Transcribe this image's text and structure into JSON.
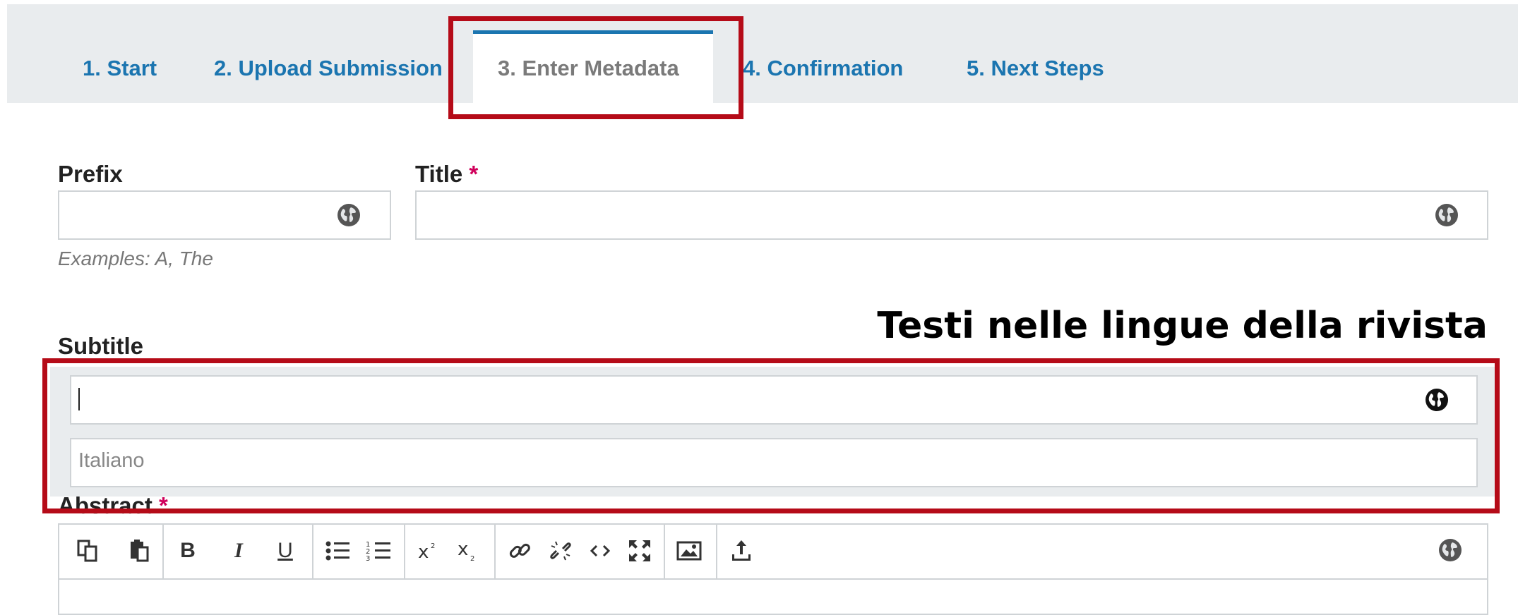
{
  "tabs": [
    {
      "label": "1. Start"
    },
    {
      "label": "2. Upload Submission"
    },
    {
      "label": "3. Enter Metadata"
    },
    {
      "label": "4. Confirmation"
    },
    {
      "label": "5. Next Steps"
    }
  ],
  "active_tab": 2,
  "form": {
    "prefix": {
      "label": "Prefix",
      "value": "",
      "hint": "Examples: A, The"
    },
    "title": {
      "label": "Title",
      "required_mark": "*",
      "value": ""
    },
    "subtitle": {
      "label": "Subtitle",
      "value": "",
      "language_field": "Italiano"
    },
    "abstract": {
      "label": "Abstract",
      "required_mark": "*"
    }
  },
  "annotation": "Testi nelle lingue della rivista",
  "editor_toolbar": {
    "buttons": [
      "copy-icon",
      "paste-icon",
      "bold-icon",
      "italic-icon",
      "underline-icon",
      "bulleted-list-icon",
      "numbered-list-icon",
      "superscript-icon",
      "subscript-icon",
      "link-icon",
      "unlink-icon",
      "code-icon",
      "fullscreen-icon",
      "image-icon",
      "upload-icon"
    ],
    "glyphs": {
      "bold": "B",
      "italic": "I",
      "underline": "U"
    }
  },
  "colors": {
    "accent": "#1b75b0",
    "highlight": "#b50b18",
    "required": "#d0005b"
  }
}
